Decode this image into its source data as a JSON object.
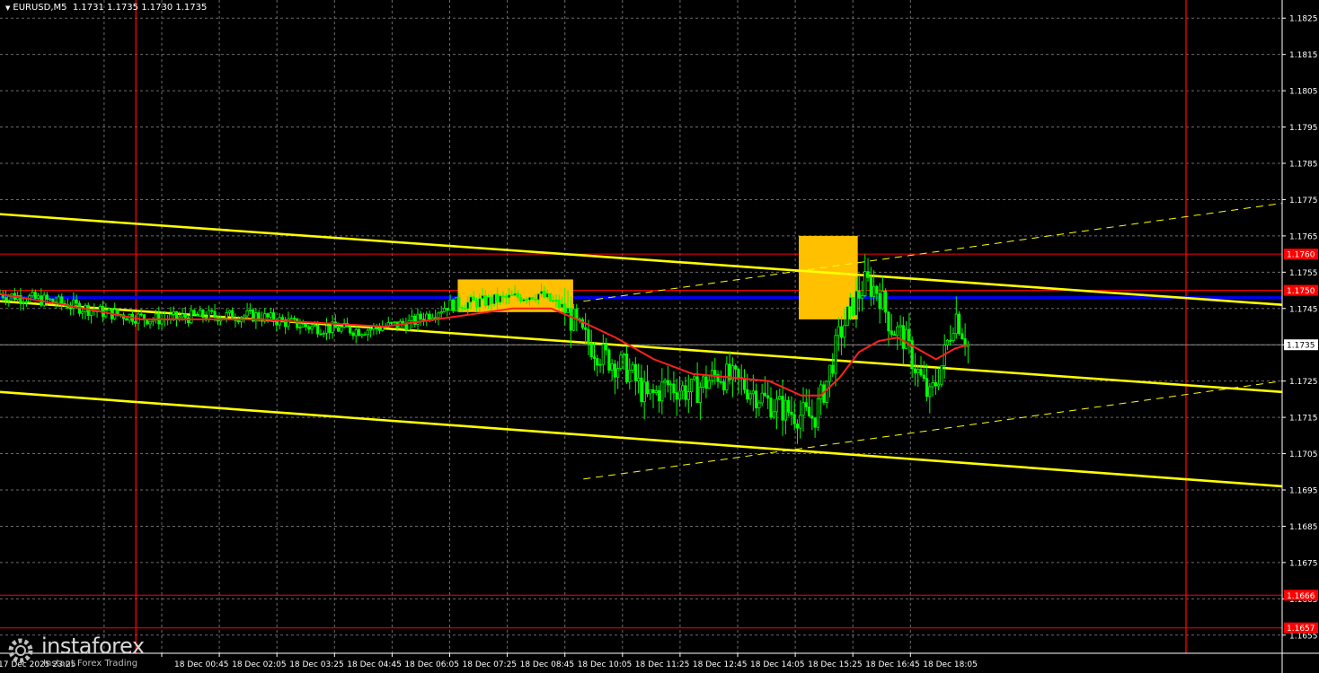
{
  "header": {
    "symbol": "EURUSD,M5",
    "ohlc": "1.1731 1.1735 1.1730 1.1735"
  },
  "branding": {
    "name": "instaforex",
    "tagline": "Instant Forex Trading"
  },
  "colors": {
    "background": "#000000",
    "grid": "#6b6b6b",
    "candle_body": "#00ff00",
    "candle_wick": "#00ff00",
    "moving_average": "#ff2020",
    "channel": "#ffff00",
    "blue_level": "#0000ff",
    "red_level": "#ff0000",
    "red_vline": "#ff0000",
    "highlight_box": "#ffc000",
    "axis_text": "#ffffff",
    "price_tag_bg": "#ff0000",
    "current_tag_bg": "#ffffff"
  },
  "chart_data": {
    "type": "candlestick",
    "title": "EURUSD,M5",
    "ylim": [
      1.165,
      1.183
    ],
    "y_ticks": [
      "1.1825",
      "1.1815",
      "1.1805",
      "1.1795",
      "1.1785",
      "1.1775",
      "1.1765",
      "1.1755",
      "1.1745",
      "1.1735",
      "1.1725",
      "1.1715",
      "1.1705",
      "1.1695",
      "1.1685",
      "1.1675",
      "1.1665",
      "1.1655"
    ],
    "x_ticks": [
      "18 Dec 00:45",
      "18 Dec 02:05",
      "18 Dec 03:25",
      "18 Dec 04:45",
      "18 Dec 06:05",
      "18 Dec 07:25",
      "18 Dec 08:45",
      "18 Dec 10:05",
      "18 Dec 11:25",
      "18 Dec 12:45",
      "18 Dec 14:05",
      "18 Dec 15:25",
      "18 Dec 16:45",
      "18 Dec 18:05"
    ],
    "x_first_partial": "17 Dec 2025 23:25",
    "grid": true,
    "price_levels": [
      {
        "value": 1.176,
        "label": "1.1760",
        "color": "#ff0000"
      },
      {
        "value": 1.175,
        "label": "1.1750",
        "color": "#ff0000"
      },
      {
        "value": 1.1666,
        "label": "1.1666",
        "color": "#ff0000"
      },
      {
        "value": 1.1657,
        "label": "1.1657",
        "color": "#ff0000"
      }
    ],
    "blue_level": {
      "value": 1.1748
    },
    "current_price": {
      "value": 1.1735,
      "label": "1.1735"
    },
    "close_path": [
      {
        "t": 0,
        "v": 1.1749
      },
      {
        "t": 0.04,
        "v": 1.1747
      },
      {
        "t": 0.08,
        "v": 1.1744
      },
      {
        "t": 0.12,
        "v": 1.1742
      },
      {
        "t": 0.16,
        "v": 1.1743
      },
      {
        "t": 0.2,
        "v": 1.1743
      },
      {
        "t": 0.24,
        "v": 1.174
      },
      {
        "t": 0.28,
        "v": 1.1739
      },
      {
        "t": 0.32,
        "v": 1.1741
      },
      {
        "t": 0.35,
        "v": 1.1746
      },
      {
        "t": 0.38,
        "v": 1.1747
      },
      {
        "t": 0.42,
        "v": 1.1749
      },
      {
        "t": 0.44,
        "v": 1.1745
      },
      {
        "t": 0.455,
        "v": 1.1737
      },
      {
        "t": 0.47,
        "v": 1.1732
      },
      {
        "t": 0.49,
        "v": 1.1728
      },
      {
        "t": 0.505,
        "v": 1.172
      },
      {
        "t": 0.52,
        "v": 1.1724
      },
      {
        "t": 0.54,
        "v": 1.1722
      },
      {
        "t": 0.56,
        "v": 1.1727
      },
      {
        "t": 0.58,
        "v": 1.1724
      },
      {
        "t": 0.6,
        "v": 1.1719
      },
      {
        "t": 0.62,
        "v": 1.1716
      },
      {
        "t": 0.635,
        "v": 1.1715
      },
      {
        "t": 0.645,
        "v": 1.1725
      },
      {
        "t": 0.655,
        "v": 1.1738
      },
      {
        "t": 0.665,
        "v": 1.1746
      },
      {
        "t": 0.675,
        "v": 1.1752
      },
      {
        "t": 0.685,
        "v": 1.175
      },
      {
        "t": 0.695,
        "v": 1.174
      },
      {
        "t": 0.705,
        "v": 1.1737
      },
      {
        "t": 0.715,
        "v": 1.1728
      },
      {
        "t": 0.725,
        "v": 1.172
      },
      {
        "t": 0.735,
        "v": 1.173
      },
      {
        "t": 0.745,
        "v": 1.1744
      },
      {
        "t": 0.755,
        "v": 1.1735
      }
    ],
    "moving_average": [
      {
        "t": 0,
        "v": 1.1749
      },
      {
        "t": 0.05,
        "v": 1.1746
      },
      {
        "t": 0.11,
        "v": 1.1742
      },
      {
        "t": 0.2,
        "v": 1.1742
      },
      {
        "t": 0.3,
        "v": 1.174
      },
      {
        "t": 0.36,
        "v": 1.1743
      },
      {
        "t": 0.4,
        "v": 1.1745
      },
      {
        "t": 0.43,
        "v": 1.1745
      },
      {
        "t": 0.45,
        "v": 1.1742
      },
      {
        "t": 0.48,
        "v": 1.1737
      },
      {
        "t": 0.51,
        "v": 1.1731
      },
      {
        "t": 0.54,
        "v": 1.1727
      },
      {
        "t": 0.57,
        "v": 1.1726
      },
      {
        "t": 0.6,
        "v": 1.1725
      },
      {
        "t": 0.625,
        "v": 1.1721
      },
      {
        "t": 0.64,
        "v": 1.1721
      },
      {
        "t": 0.655,
        "v": 1.1726
      },
      {
        "t": 0.67,
        "v": 1.1733
      },
      {
        "t": 0.685,
        "v": 1.1736
      },
      {
        "t": 0.7,
        "v": 1.1737
      },
      {
        "t": 0.715,
        "v": 1.1734
      },
      {
        "t": 0.73,
        "v": 1.1731
      },
      {
        "t": 0.745,
        "v": 1.1734
      },
      {
        "t": 0.755,
        "v": 1.1735
      }
    ],
    "channel_lines": [
      {
        "from": {
          "t": 0,
          "v": 1.1771
        },
        "to": {
          "t": 1,
          "v": 1.1746
        },
        "style": "solid"
      },
      {
        "from": {
          "t": 0,
          "v": 1.1747
        },
        "to": {
          "t": 1,
          "v": 1.1722
        },
        "style": "solid"
      },
      {
        "from": {
          "t": 0,
          "v": 1.1722
        },
        "to": {
          "t": 1,
          "v": 1.1696
        },
        "style": "solid"
      },
      {
        "from": {
          "t": 0.455,
          "v": 1.1747
        },
        "to": {
          "t": 1,
          "v": 1.1774
        },
        "style": "dashed"
      },
      {
        "from": {
          "t": 0.455,
          "v": 1.1698
        },
        "to": {
          "t": 1,
          "v": 1.1725
        },
        "style": "dashed"
      }
    ],
    "highlight_boxes": [
      {
        "t_start": 0.357,
        "t_end": 0.447,
        "v_top": 1.1753,
        "v_bottom": 1.1744
      },
      {
        "t_start": 0.623,
        "t_end": 0.669,
        "v_top": 1.1765,
        "v_bottom": 1.1742
      }
    ],
    "vertical_lines": [
      {
        "t": 0.106,
        "color": "#ff0000"
      },
      {
        "t": 0.925,
        "color": "#ff0000"
      }
    ]
  }
}
